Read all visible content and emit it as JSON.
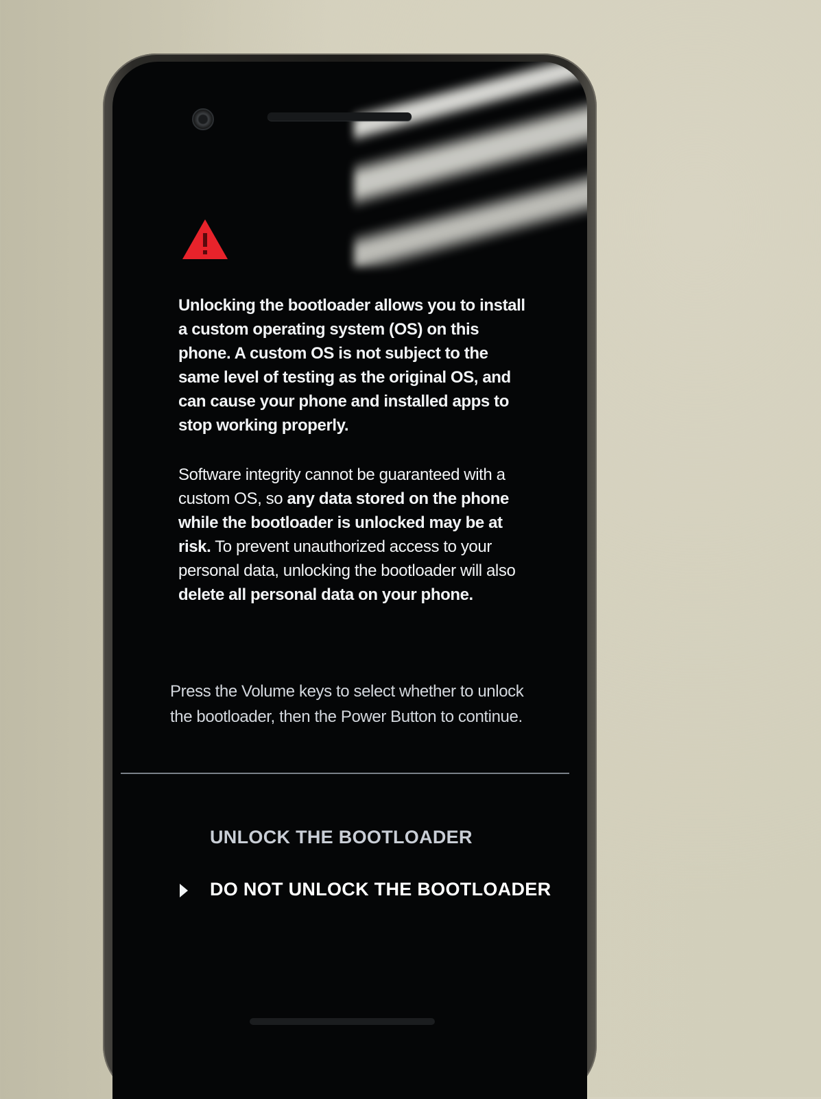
{
  "warning": {
    "icon": "warning-triangle-icon",
    "color": "#e8232b"
  },
  "body": {
    "paragraph1": "Unlocking the bootloader allows you to install a custom operating system (OS) on this phone. A custom OS is not subject to the same level of testing as the original OS, and can cause your phone and installed apps to stop working properly.",
    "paragraph2": {
      "part1": "Software integrity cannot be guaranteed with a custom OS, so ",
      "part2_bold": "any data stored on the phone while the bootloader is unlocked may be at risk.",
      "part3": " To prevent unauthorized access to your personal data, unlocking the bootloader will also ",
      "part4_bold": "delete all personal data on your phone."
    },
    "instructions": "Press the Volume keys to select whether to unlock the bootloader, then the Power Button to continue."
  },
  "menu": {
    "options": [
      {
        "label": "UNLOCK THE BOOTLOADER"
      },
      {
        "label": "DO NOT UNLOCK THE BOOTLOADER"
      }
    ],
    "selected_label": "DO NOT UNLOCK THE BOOTLOADER",
    "selector_icon": "triangle-pointer-icon"
  }
}
